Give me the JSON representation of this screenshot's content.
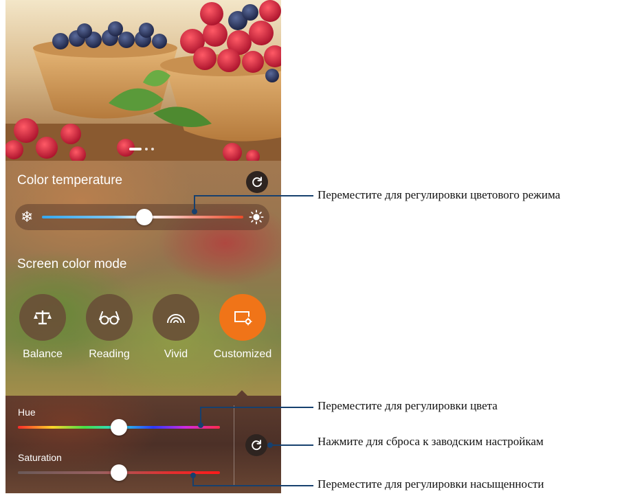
{
  "color_temperature": {
    "title": "Color temperature",
    "value_percent": 51,
    "cold_icon": "snowflake-icon",
    "warm_icon": "sun-icon",
    "reset_icon": "refresh-icon"
  },
  "screen_color_mode": {
    "title": "Screen color mode",
    "modes": [
      {
        "label": "Balance",
        "icon": "scale-icon",
        "active": false
      },
      {
        "label": "Reading",
        "icon": "glasses-icon",
        "active": false
      },
      {
        "label": "Vivid",
        "icon": "rainbow-icon",
        "active": false
      },
      {
        "label": "Customized",
        "icon": "custom-screen-icon",
        "active": true
      }
    ],
    "active_color": "#f07418"
  },
  "hue": {
    "label": "Hue",
    "value_percent": 50
  },
  "saturation": {
    "label": "Saturation",
    "value_percent": 50
  },
  "pager": {
    "pages": 3,
    "current": 1
  },
  "callouts": {
    "temperature": "Переместите для регулировки цветового режима",
    "hue": "Переместите для регулировки цвета",
    "reset": "Нажмите для сброса к заводским настройкам",
    "saturation": "Переместите для регулировки насыщенности"
  },
  "callout_color": "#16406e"
}
